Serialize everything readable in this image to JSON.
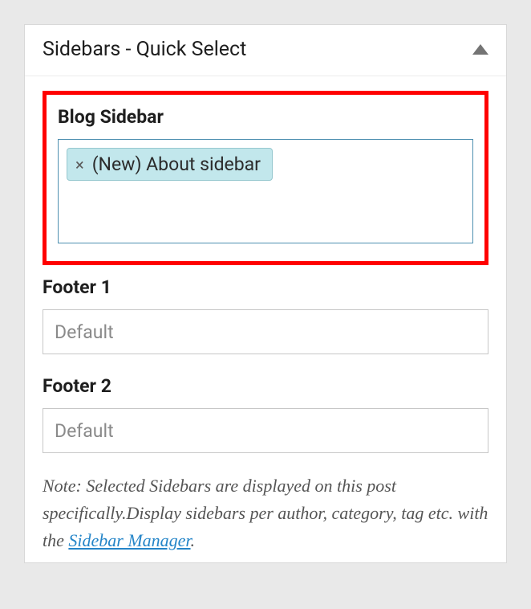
{
  "metabox": {
    "title": "Sidebars - Quick Select"
  },
  "sections": {
    "blog": {
      "label": "Blog Sidebar",
      "token": {
        "remove_glyph": "×",
        "label": "(New) About sidebar"
      },
      "placeholder": ""
    },
    "footer1": {
      "label": "Footer 1",
      "placeholder": "Default"
    },
    "footer2": {
      "label": "Footer 2",
      "placeholder": "Default"
    }
  },
  "note": {
    "text_before": "Note: Selected Sidebars are displayed on this post specifically.Display sidebars per author, category, tag etc. with the ",
    "link_text": "Sidebar Manager",
    "text_after": "."
  }
}
